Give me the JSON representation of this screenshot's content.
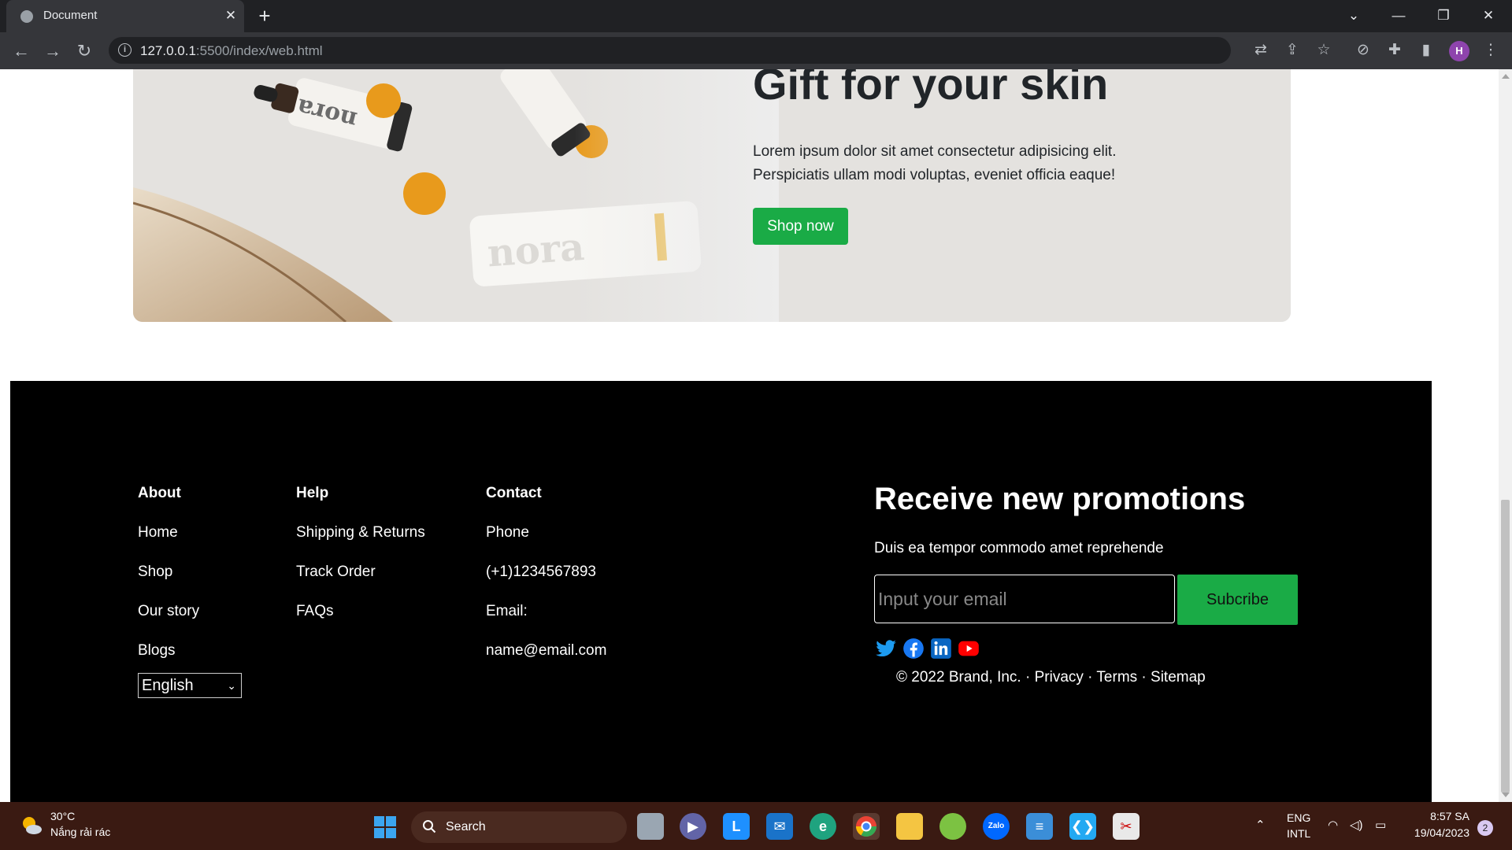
{
  "browser": {
    "tab_title": "Document",
    "url_host": "127.0.0.1",
    "url_path": ":5500/index/web.html",
    "profile_initial": "H"
  },
  "banner": {
    "title": "Gift for your skin",
    "text": "Lorem ipsum dolor sit amet consectetur adipisicing elit. Perspiciatis ullam modi voluptas, eveniet officia eaque!",
    "button": "Shop now",
    "product_brand": "nora"
  },
  "footer": {
    "about": {
      "heading": "About",
      "links": [
        "Home",
        "Shop",
        "Our story",
        "Blogs"
      ]
    },
    "help": {
      "heading": "Help",
      "links": [
        "Shipping & Returns",
        "Track Order",
        "FAQs"
      ]
    },
    "contact": {
      "heading": "Contact",
      "lines": [
        "Phone",
        "(+1)1234567893",
        "Email:",
        "name@email.com"
      ]
    },
    "language": "English",
    "promo_title": "Receive new promotions",
    "promo_sub": "Duis ea tempor commodo amet reprehende",
    "email_placeholder": "Input your email",
    "subscribe": "Subcribe",
    "copyright": "© 2022 Brand, Inc. · Privacy · Terms · Sitemap"
  },
  "taskbar": {
    "temp": "30°C",
    "weather": "Nắng rải rác",
    "search": "Search",
    "lang_top": "ENG",
    "lang_bottom": "INTL",
    "time": "8:57 SA",
    "date": "19/04/2023",
    "notifications": "2"
  },
  "colors": {
    "accent": "#1aab46",
    "footer_bg": "#000000"
  }
}
